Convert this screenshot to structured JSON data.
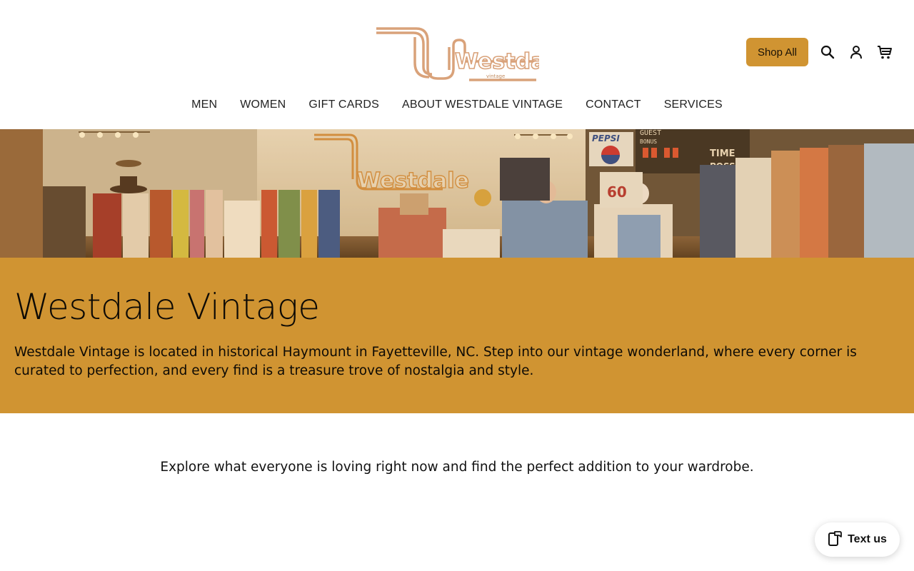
{
  "header": {
    "logo_text": "Westdale",
    "logo_sub": "vintage",
    "shop_all_label": "Shop All",
    "icons": [
      "search-icon",
      "account-icon",
      "cart-icon"
    ]
  },
  "nav": {
    "items": [
      {
        "label": "MEN"
      },
      {
        "label": "WOMEN"
      },
      {
        "label": "GIFT CARDS"
      },
      {
        "label": "ABOUT WESTDALE VINTAGE"
      },
      {
        "label": "CONTACT"
      },
      {
        "label": "SERVICES"
      }
    ]
  },
  "hero": {
    "sign_text": "Westdale",
    "scoreboard_guest": "GUEST",
    "scoreboard_bonus": "BONUS",
    "scoreboard_time": "TIME",
    "scoreboard_poss": "POSS",
    "pepsi": "PEPSI"
  },
  "band": {
    "title": "Westdale Vintage",
    "description": "Westdale Vintage is located in historical Haymount in Fayetteville, NC. Step into our vintage wonderland, where every corner is curated to perfection, and every find is a treasure trove of nostalgia and style."
  },
  "explore": {
    "text": "Explore what everyone is loving right now and find the perfect addition to your wardrobe."
  },
  "chat": {
    "label": "Text us"
  },
  "colors": {
    "accent": "#d09432",
    "logo_stroke": "#d9a27a",
    "text": "#111111"
  }
}
